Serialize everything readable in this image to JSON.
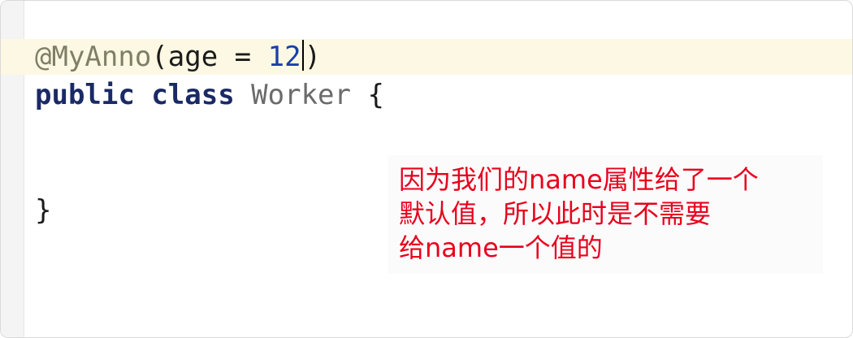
{
  "editor": {
    "line1": {
      "annotation": "@MyAnno",
      "open": "(",
      "param": "age = ",
      "value_before_caret": "12",
      "close": ")"
    },
    "line2": {
      "kw_public": "public",
      "kw_class": "class",
      "class_name": "Worker",
      "brace": "{"
    },
    "line3": {
      "brace": "}"
    }
  },
  "note": {
    "lines": [
      "因为我们的name属性给了一个",
      "默认值，所以此时是不需要",
      "给name一个值的"
    ]
  },
  "colors": {
    "note_text": "#e8001c",
    "current_line_bg": "#fdf8e3",
    "keyword": "#1a2a66",
    "number": "#1a3fa8"
  }
}
